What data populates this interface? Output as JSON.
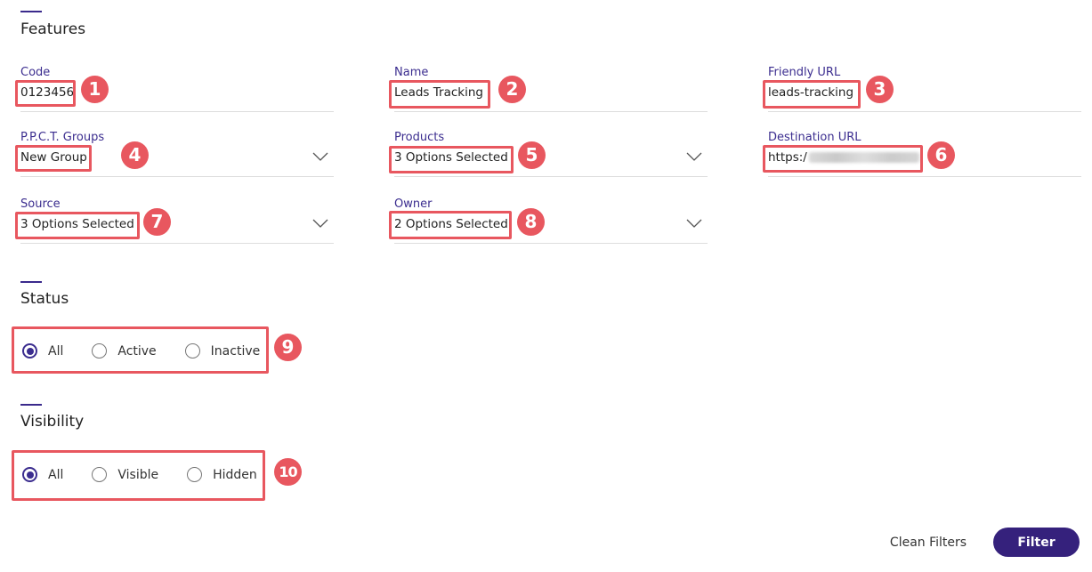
{
  "features": {
    "title": "Features",
    "code": {
      "label": "Code",
      "value": "0123456"
    },
    "name": {
      "label": "Name",
      "value": "Leads Tracking"
    },
    "friendly_url": {
      "label": "Friendly URL",
      "value": "leads-tracking"
    },
    "ppct_groups": {
      "label": "P.P.C.T. Groups",
      "value": "New Group"
    },
    "products": {
      "label": "Products",
      "value": "3 Options Selected"
    },
    "destination_url": {
      "label": "Destination URL",
      "value": "https:/"
    },
    "source": {
      "label": "Source",
      "value": "3 Options Selected"
    },
    "owner": {
      "label": "Owner",
      "value": "2 Options Selected"
    }
  },
  "status": {
    "title": "Status",
    "options": [
      "All",
      "Active",
      "Inactive"
    ],
    "selected": "All"
  },
  "visibility": {
    "title": "Visibility",
    "options": [
      "All",
      "Visible",
      "Hidden"
    ],
    "selected": "All"
  },
  "annotations": [
    "1",
    "2",
    "3",
    "4",
    "5",
    "6",
    "7",
    "8",
    "9",
    "10"
  ],
  "actions": {
    "clean_label": "Clean Filters",
    "filter_label": "Filter"
  },
  "colors": {
    "accent": "#35217c",
    "label": "#3b2d8f",
    "highlight": "#e8575f"
  }
}
